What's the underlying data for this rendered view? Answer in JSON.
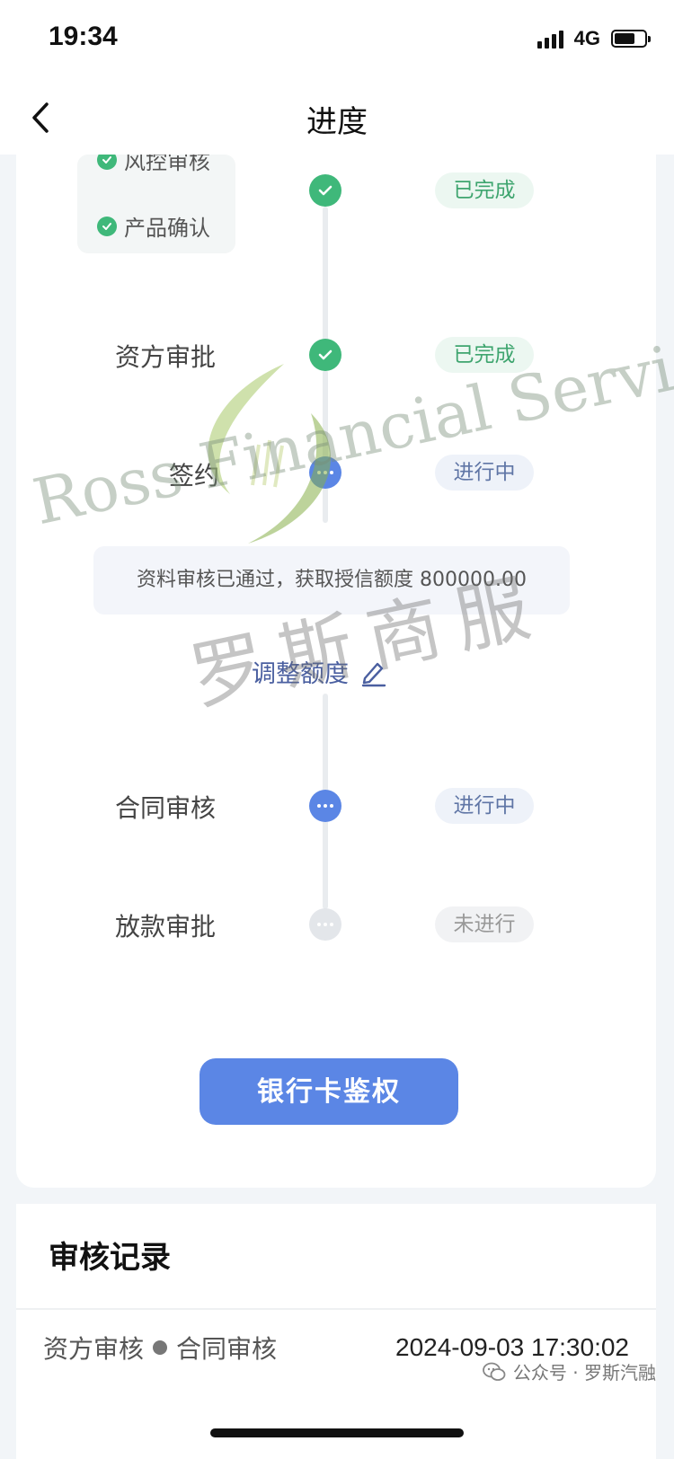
{
  "status_bar": {
    "time": "19:34",
    "network": "4G",
    "battery_level": 0.7
  },
  "nav": {
    "title": "进度"
  },
  "progress": {
    "substeps": [
      {
        "label": "风控审核"
      },
      {
        "label": "产品确认"
      }
    ],
    "steps": [
      {
        "label": "",
        "status": "已完成",
        "state": "done"
      },
      {
        "label": "资方审批",
        "status": "已完成",
        "state": "done"
      },
      {
        "label": "签约",
        "status": "进行中",
        "state": "in-progress"
      },
      {
        "label": "合同审核",
        "status": "进行中",
        "state": "in-progress"
      },
      {
        "label": "放款审批",
        "status": "未进行",
        "state": "pending"
      }
    ],
    "info_message": "资料审核已通过，获取授信额度 800000.00",
    "adjust_label": "调整额度",
    "button_label": "银行卡鉴权"
  },
  "review": {
    "title": "审核记录",
    "records": [
      {
        "from": "资方审核",
        "to": "合同审核",
        "time": "2024-09-03 17:30:02"
      }
    ]
  },
  "watermark": {
    "english": "Ross Financial Services",
    "chinese": "罗斯商服"
  },
  "footer": {
    "credit": "公众号 · 罗斯汽融"
  },
  "colors": {
    "accent_blue": "#5b86e5",
    "done_green": "#3fb87a",
    "pending_gray": "#e3e6ea"
  }
}
